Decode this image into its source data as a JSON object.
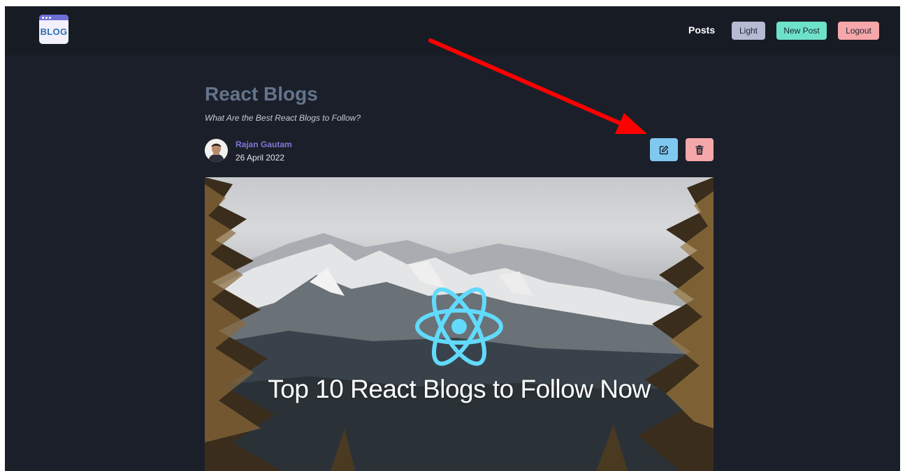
{
  "navbar": {
    "logo_text": "BLOG",
    "links": {
      "posts": "Posts"
    },
    "buttons": {
      "light": "Light",
      "new_post": "New Post",
      "logout": "Logout"
    }
  },
  "post": {
    "title": "React Blogs",
    "subtitle": "What Are the Best React Blogs to Follow?",
    "author": {
      "name": "Rajan Gautam",
      "date": "26 April 2022"
    },
    "actions": {
      "edit_icon": "edit-icon",
      "delete_icon": "trash-icon"
    },
    "cover": {
      "caption": "Top 10 React Blogs to Follow Now",
      "logo": "react-logo"
    }
  },
  "colors": {
    "background": "#1b1f2a",
    "navbar": "#171b24",
    "edit": "#7fc8f0",
    "delete": "#f6a7a9",
    "new_post": "#6ee2c8",
    "light": "#b6bbd3",
    "author": "#7c79d3",
    "annotation_arrow": "#ff0000"
  }
}
